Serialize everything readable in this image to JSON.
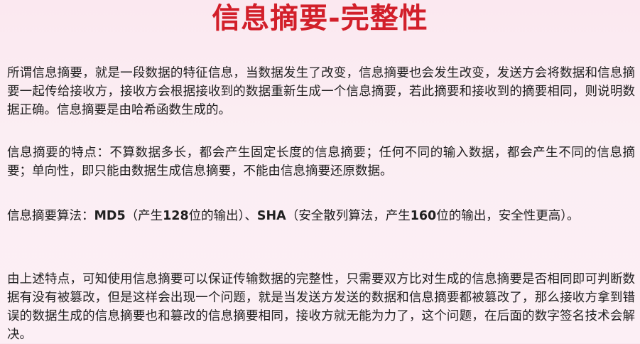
{
  "title": "信息摘要-完整性",
  "paragraphs": {
    "p1": "所谓信息摘要，就是一段数据的特征信息，当数据发生了改变，信息摘要也会发生改变，发送方会将数据和信息摘要一起传给接收方，接收方会根据接收到的数据重新生成一个信息摘要，若此摘要和接收到的摘要相同，则说明数据正确。信息摘要是由哈希函数生成的。",
    "p2": "信息摘要的特点：不算数据多长，都会产生固定长度的信息摘要；任何不同的输入数据，都会产生不同的信息摘要；单向性，即只能由数据生成信息摘要，不能由信息摘要还原数据。",
    "p3": {
      "prefix": "信息摘要算法：",
      "md5": "MD5",
      "mid1": "（产生",
      "bits128": "128",
      "mid2": "位的输出）、",
      "sha": "SHA",
      "mid3": "（安全散列算法，产生",
      "bits160": "160",
      "suffix": "位的输出，安全性更高）。"
    },
    "p4": "由上述特点，可知使用信息摘要可以保证传输数据的完整性，只需要双方比对生成的信息摘要是否相同即可判断数据有没有被篡改，但是这样会出现一个问题，就是当发送方发送的数据和信息摘要都被篡改了，那么接收方拿到错误的数据生成的信息摘要也和篡改的信息摘要相同，接收方就无能为力了，这个问题，在后面的数字签名技术会解决。"
  }
}
